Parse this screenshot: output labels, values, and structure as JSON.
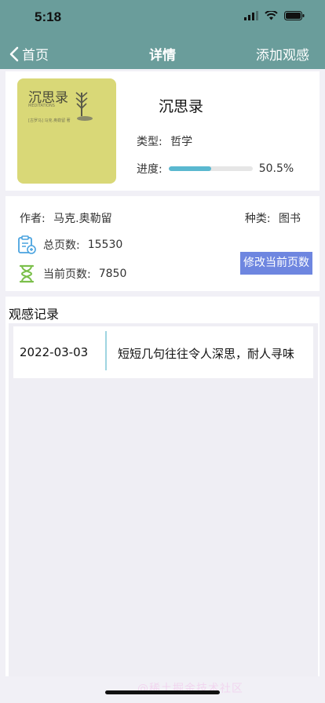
{
  "status_bar": {
    "time": "5:18"
  },
  "nav": {
    "back_label": "首页",
    "title": "详情",
    "action_label": "添加观感"
  },
  "book": {
    "cover_title": "沉思录",
    "cover_subtitle": "MEDITATIONS",
    "cover_author": "[古罗马] 马克.奥勒留 著",
    "title": "沉思录",
    "type_label": "类型:",
    "type_value": "哲学",
    "progress_label": "进度:",
    "progress_value": 0.505,
    "progress_text": "50.5%"
  },
  "info": {
    "author_label": "作者:",
    "author_value": "马克.奥勒留",
    "category_label": "种类:",
    "category_value": "图书",
    "total_pages_label": "总页数:",
    "total_pages_value": "15530",
    "current_pages_label": "当前页数:",
    "current_pages_value": "7850",
    "edit_button_label": "修改当前页数"
  },
  "notes": {
    "title": "观感记录",
    "records": [
      {
        "date": "2022-03-03",
        "text": "短短几句往往令人深思，耐人寻味"
      }
    ]
  },
  "watermark": "@稀土掘金技术社区",
  "colors": {
    "header": "#6a9d9b",
    "progress": "#5ab8d0",
    "button": "#6e86e0"
  }
}
